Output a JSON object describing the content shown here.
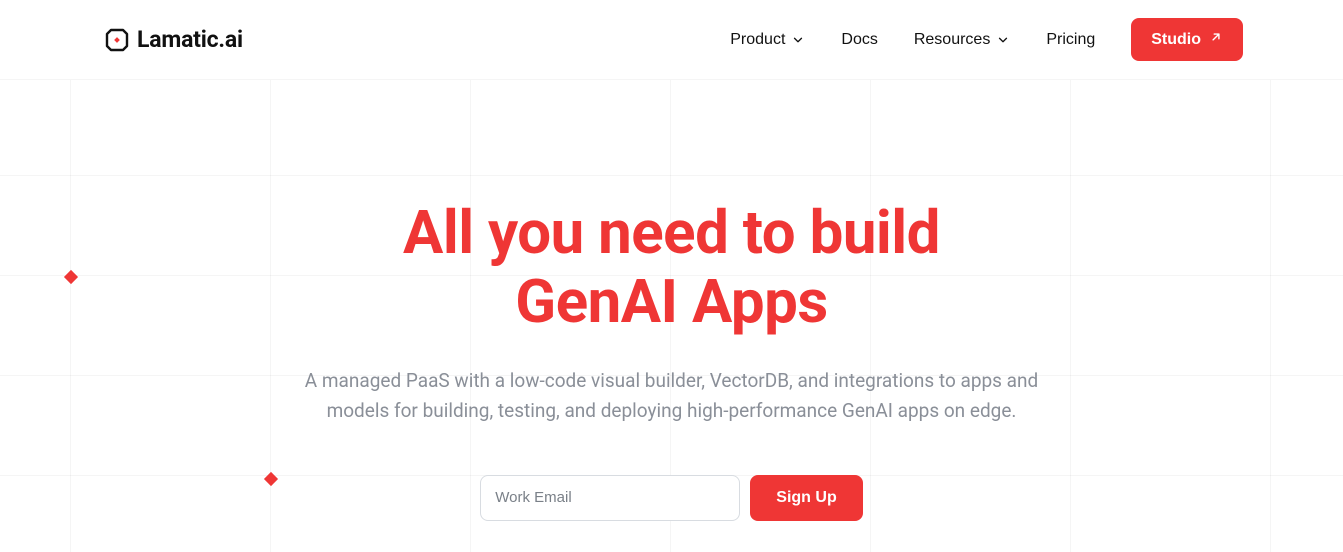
{
  "brand": {
    "name": "Lamatic.ai"
  },
  "nav": {
    "items": [
      {
        "label": "Product",
        "hasDropdown": true
      },
      {
        "label": "Docs",
        "hasDropdown": false
      },
      {
        "label": "Resources",
        "hasDropdown": true
      },
      {
        "label": "Pricing",
        "hasDropdown": false
      }
    ],
    "cta": {
      "label": "Studio"
    }
  },
  "hero": {
    "title_line1": "All you need to build",
    "title_line2": "GenAI Apps",
    "subtitle": "A managed PaaS with a low-code visual builder, VectorDB, and integrations to apps and models for building, testing, and deploying high-performance GenAI apps on edge."
  },
  "signup": {
    "placeholder": "Work Email",
    "button": "Sign Up"
  },
  "colors": {
    "accent": "#ef3635",
    "text": "#111111",
    "muted": "#8a8f98"
  }
}
